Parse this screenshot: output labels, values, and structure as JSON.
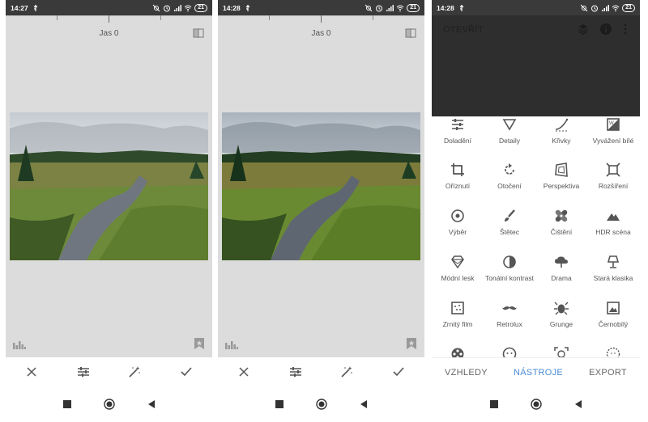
{
  "screens": [
    {
      "status": {
        "time": "14:27",
        "battery": "21"
      },
      "adjustment_label": "Jas 0"
    },
    {
      "status": {
        "time": "14:28",
        "battery": "21"
      },
      "adjustment_label": "Jas 0"
    },
    {
      "status": {
        "time": "14:28",
        "battery": "21"
      },
      "appbar": {
        "open_label": "OTEVŘÍT"
      },
      "tools": [
        {
          "label": "Doladění",
          "icon": "tune-icon"
        },
        {
          "label": "Detaily",
          "icon": "triangle-down-icon"
        },
        {
          "label": "Křivky",
          "icon": "curves-icon"
        },
        {
          "label": "Vyvážení bílé",
          "icon": "white-balance-icon"
        },
        {
          "label": "Oříznutí",
          "icon": "crop-icon"
        },
        {
          "label": "Otočení",
          "icon": "rotate-icon"
        },
        {
          "label": "Perspektiva",
          "icon": "perspective-icon"
        },
        {
          "label": "Rozšíření",
          "icon": "expand-icon"
        },
        {
          "label": "Výběr",
          "icon": "selective-icon"
        },
        {
          "label": "Štětec",
          "icon": "brush-icon"
        },
        {
          "label": "Čištění",
          "icon": "healing-icon"
        },
        {
          "label": "HDR scéna",
          "icon": "mountain-icon"
        },
        {
          "label": "Módní lesk",
          "icon": "diamond-icon"
        },
        {
          "label": "Tonální kontrast",
          "icon": "tonal-contrast-icon"
        },
        {
          "label": "Drama",
          "icon": "cloud-icon"
        },
        {
          "label": "Stará klasika",
          "icon": "lamp-icon"
        },
        {
          "label": "Zrnitý film",
          "icon": "grain-icon"
        },
        {
          "label": "Retrolux",
          "icon": "mustache-icon"
        },
        {
          "label": "Grunge",
          "icon": "grunge-icon"
        },
        {
          "label": "Černobílý",
          "icon": "bw-icon"
        },
        {
          "label": "",
          "icon": "film-reel-icon"
        },
        {
          "label": "",
          "icon": "face-icon"
        },
        {
          "label": "",
          "icon": "face-pose-icon"
        },
        {
          "label": "",
          "icon": "frames-icon"
        }
      ],
      "tabs": [
        {
          "label": "VZHLEDY",
          "active": false
        },
        {
          "label": "NÁSTROJE",
          "active": true
        },
        {
          "label": "EXPORT",
          "active": false
        }
      ]
    }
  ],
  "colors": {
    "accent": "#4a8bd4",
    "statusbar": "#3a3a3a",
    "editor_bg": "#dcdcdc",
    "appbar": "#2e2e2e"
  }
}
